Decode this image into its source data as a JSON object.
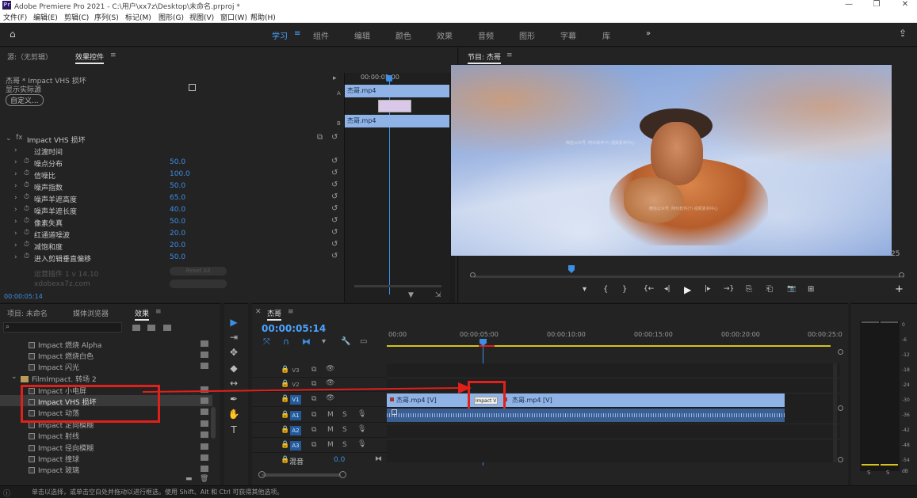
{
  "titlebar": {
    "logo": "Pr",
    "title": "Adobe Premiere Pro 2021 - C:\\用户\\xx7z\\Desktop\\未命名.prproj *",
    "min": "—",
    "max": "❐",
    "close": "✕"
  },
  "menu": [
    "文件(F)",
    "编辑(E)",
    "剪辑(C)",
    "序列(S)",
    "标记(M)",
    "图形(G)",
    "视图(V)",
    "窗口(W)",
    "帮助(H)"
  ],
  "workspaces": [
    "学习",
    "组件",
    "编辑",
    "颜色",
    "效果",
    "音频",
    "图形",
    "字幕",
    "库"
  ],
  "workspace_active": "学习",
  "workspace_more": "»",
  "source_panel": {
    "tab_source": "源:（无剪辑）",
    "tab_effect_controls": "效果控件",
    "menu_glyph": "≡",
    "clip_header": "杰哥 * Impact VHS 损坏",
    "show_actual_source": "显示实际源",
    "custom_button": "自定义...",
    "effect_name": "Impact VHS 损坏",
    "props": [
      {
        "label": "过渡时间",
        "value": ""
      },
      {
        "label": "噪点分布",
        "value": "50.0"
      },
      {
        "label": "信噪比",
        "value": "100.0"
      },
      {
        "label": "噪声指数",
        "value": "50.0"
      },
      {
        "label": "噪声羊遮高度",
        "value": "65.0"
      },
      {
        "label": "噪声羊遮长度",
        "value": "40.0"
      },
      {
        "label": "像素失真",
        "value": "50.0"
      },
      {
        "label": "红通道噪波",
        "value": "20.0"
      },
      {
        "label": "减饱和度",
        "value": "20.0"
      },
      {
        "label": "进入剪辑垂直偏移",
        "value": "50.0"
      }
    ],
    "faded1": "运营插件 1 v 14.10",
    "faded2": "xdobexx7z.com",
    "faded_btn": "Reset All",
    "timecode": "00:00:05:14",
    "mini_timecode": "00:00:05:00",
    "mini_clip_a": "杰哥.mp4",
    "mini_clip_b": "杰哥.mp4",
    "mini_a": "A",
    "mini_b": "B"
  },
  "program_panel": {
    "title": "节目: 杰哥",
    "menu_glyph": "≡",
    "corner_number": "25",
    "controls": [
      "▾",
      "{",
      "}",
      "{←",
      "◂|",
      "▶",
      "|▸",
      "→}",
      "⎘",
      "⎗",
      "📷",
      "⊞"
    ],
    "add": "+",
    "watermarks": [
      "微信公众号: 阿玲软件(Y) 视频素材中心",
      "微信公众号: 阿玲软件(Y) 视频素材中心"
    ]
  },
  "project_panel": {
    "tabs": [
      "项目: 未命名",
      "媒体浏览器",
      "效果"
    ],
    "active_tab": "效果",
    "menu_glyph": "≡",
    "effects": [
      {
        "name": "Impact 燃烧 Alpha",
        "indent": 2,
        "highlight": false
      },
      {
        "name": "Impact 燃烧白色",
        "indent": 2,
        "highlight": false
      },
      {
        "name": "Impact 闪光",
        "indent": 2,
        "highlight": false
      },
      {
        "name": "FilmImpact. 转场 2",
        "indent": 1,
        "highlight": false
      },
      {
        "name": "Impact 小电屏",
        "indent": 2,
        "highlight": false
      },
      {
        "name": "Impact VHS 损坏",
        "indent": 2,
        "highlight": true
      },
      {
        "name": "Impact 动荡",
        "indent": 2,
        "highlight": false
      },
      {
        "name": "Impact 定向模糊",
        "indent": 2,
        "highlight": false
      },
      {
        "name": "Impact 射线",
        "indent": 2,
        "highlight": false
      },
      {
        "name": "Impact 径向模糊",
        "indent": 2,
        "highlight": false
      },
      {
        "name": "Impact 撞球",
        "indent": 2,
        "highlight": false
      },
      {
        "name": "Impact 玻璃",
        "indent": 2,
        "highlight": false
      }
    ]
  },
  "tools": [
    "▶",
    "⇥",
    "✥",
    "◆",
    "↔",
    "✒",
    "✋",
    "T"
  ],
  "timeline": {
    "tab": "杰哥",
    "menu_glyph": "≡",
    "timecode": "00:00:05:14",
    "ruler": [
      "00:00",
      "00:00:05:00",
      "00:00:10:00",
      "00:00:15:00",
      "00:00:20:00",
      "00:00:25:0"
    ],
    "tracks_video": [
      "V3",
      "V2",
      "V1"
    ],
    "tracks_audio": [
      "A1",
      "A2",
      "A3"
    ],
    "mix_label": "混音",
    "mix_value": "0.0",
    "clip_v_left": "杰哥.mp4 [V]",
    "clip_v_right": "杰哥.mp4 [V]",
    "transition_label": "Impact V",
    "track_letters": [
      "M",
      "S"
    ]
  },
  "meter": {
    "scale": [
      "0",
      "-6",
      "-12",
      "-18",
      "-24",
      "-30",
      "-36",
      "-42",
      "-48",
      "-54",
      "dB"
    ],
    "solo": [
      "S",
      "S"
    ]
  },
  "statusbar": "单击以选择，或单击空白处并拖动以进行框选。使用 Shift、Alt 和 Ctrl 可获得其他选项。",
  "colors": {
    "accent": "#3d8ee6",
    "annotation": "#e0201a",
    "video_clip": "#8fb3e6",
    "audio_clip": "#3c5f93",
    "yellow_bar": "#d6c21a"
  }
}
